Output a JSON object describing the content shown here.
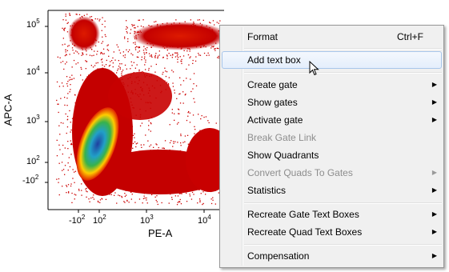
{
  "plot": {
    "y_axis_label": "APC-A",
    "x_axis_label": "PE-A",
    "y_ticks": [
      "10",
      "5",
      "10",
      "4",
      "10",
      "3",
      "10",
      "2",
      "-10",
      "2"
    ],
    "x_ticks": [
      "-10",
      "2",
      "10",
      "2",
      "10",
      "3",
      "10",
      "4"
    ],
    "palette": {
      "low": "#cc0000",
      "mid": "#ffcc00",
      "high": "#1f3fa0"
    }
  },
  "menu": {
    "items": [
      {
        "label": "Format",
        "shortcut": "Ctrl+F"
      },
      {
        "label": "Add text box"
      },
      {
        "label": "Create gate"
      },
      {
        "label": "Show gates"
      },
      {
        "label": "Activate gate"
      },
      {
        "label": "Break Gate Link"
      },
      {
        "label": "Show Quadrants"
      },
      {
        "label": "Convert Quads To Gates"
      },
      {
        "label": "Statistics"
      },
      {
        "label": "Recreate Gate Text Boxes"
      },
      {
        "label": "Recreate Quad Text Boxes"
      },
      {
        "label": "Compensation"
      }
    ],
    "hover_item": "Add text box"
  },
  "icons": {
    "submenu": "chevron-right-icon",
    "pointer": "mouse-pointer-icon"
  }
}
